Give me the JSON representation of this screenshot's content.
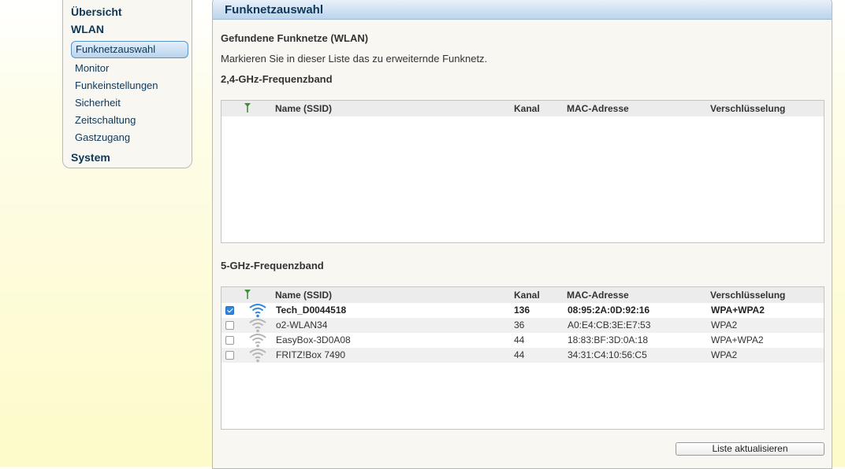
{
  "sidebar": {
    "overview": "Übersicht",
    "wlan": "WLAN",
    "items": [
      {
        "label": "Funknetzauswahl"
      },
      {
        "label": "Monitor"
      },
      {
        "label": "Funkeinstellungen"
      },
      {
        "label": "Sicherheit"
      },
      {
        "label": "Zeitschaltung"
      },
      {
        "label": "Gastzugang"
      }
    ],
    "system": "System"
  },
  "main": {
    "title": "Funknetzauswahl",
    "found_heading": "Gefundene Funknetze (WLAN)",
    "instruction": "Markieren Sie in dieser Liste das zu erweiternde Funknetz.",
    "band24_title": "2,4-GHz-Frequenzband",
    "band5_title": "5-GHz-Frequenzband",
    "columns": {
      "name": "Name (SSID)",
      "channel": "Kanal",
      "mac": "MAC-Adresse",
      "encryption": "Verschlüsselung"
    },
    "band24_networks": [],
    "band5_networks": [
      {
        "selected": true,
        "ssid": "Tech_D0044518",
        "channel": "136",
        "mac": "08:95:2A:0D:92:16",
        "encryption": "WPA+WPA2"
      },
      {
        "selected": false,
        "ssid": "o2-WLAN34",
        "channel": "36",
        "mac": "A0:E4:CB:3E:E7:53",
        "encryption": "WPA2"
      },
      {
        "selected": false,
        "ssid": "EasyBox-3D0A08",
        "channel": "44",
        "mac": "18:83:BF:3D:0A:18",
        "encryption": "WPA+WPA2"
      },
      {
        "selected": false,
        "ssid": "FRITZ!Box 7490",
        "channel": "44",
        "mac": "34:31:C4:10:56:C5",
        "encryption": "WPA2"
      }
    ],
    "refresh_button": "Liste aktualisieren"
  },
  "colors": {
    "nav_text": "#0f3758",
    "accent_blue": "#2f86e0",
    "wifi_active": "#2f86e0",
    "wifi_inactive": "#b5b5b5",
    "antenna_green": "#3f8f3f"
  },
  "icons": {
    "signal": "wifi-signal-icon",
    "signal_strength_header": "antenna-icon"
  }
}
